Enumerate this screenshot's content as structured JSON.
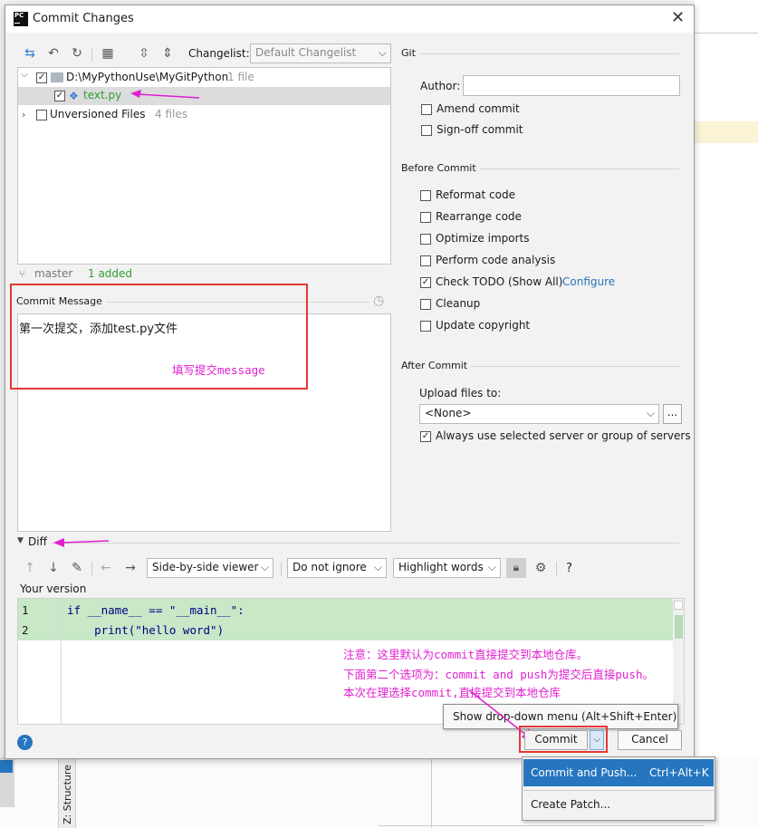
{
  "title": "Commit Changes",
  "toolbar": {
    "changelist_label": "Changelist:",
    "changelist_value": "Default Changelist"
  },
  "tree": {
    "root": {
      "path": "D:\\MyPythonUse\\MyGitPython",
      "count": "1 file"
    },
    "file": "text.py",
    "unversioned": {
      "label": "Unversioned Files",
      "count": "4 files"
    }
  },
  "status": {
    "branch": "master",
    "summary": "1 added"
  },
  "commit_message": {
    "label": "Commit Message",
    "text": "第一次提交，添加test.py文件",
    "annotation": "填写提交message"
  },
  "git": {
    "section": "Git",
    "author_label": "Author:",
    "author_value": "",
    "amend": "Amend commit",
    "signoff": "Sign-off commit"
  },
  "before_commit": {
    "section": "Before Commit",
    "options": [
      {
        "label": "Reformat code",
        "checked": false
      },
      {
        "label": "Rearrange code",
        "checked": false
      },
      {
        "label": "Optimize imports",
        "checked": false
      },
      {
        "label": "Perform code analysis",
        "checked": false
      },
      {
        "label": "Check TODO (Show All)",
        "checked": true
      },
      {
        "label": "Cleanup",
        "checked": false
      },
      {
        "label": "Update copyright",
        "checked": false
      }
    ],
    "configure_link": "Configure"
  },
  "after_commit": {
    "section": "After Commit",
    "upload_label": "Upload files to:",
    "upload_value": "<None>",
    "browse": "...",
    "always_use": "Always use selected server or group of servers"
  },
  "diff": {
    "label": "Diff",
    "viewer": "Side-by-side viewer",
    "ignore": "Do not ignore",
    "highlight": "Highlight words",
    "help": "?",
    "your_version": "Your version",
    "lines": [
      {
        "num": "1",
        "code": "if __name__ == \"__main__\":"
      },
      {
        "num": "2",
        "code": "    print(\"hello word\")"
      }
    ]
  },
  "notes": [
    "注意：这里默认为commit直接提交到本地仓库。",
    "下面第二个选项为：commit and push为提交后直接push。",
    "本次在理选择commit,直接提交到本地仓库"
  ],
  "tooltip": "Show drop-down menu (Alt+Shift+Enter)",
  "buttons": {
    "commit": "Commit",
    "cancel": "Cancel",
    "help": "?"
  },
  "dropdown": {
    "items": [
      {
        "label": "Commit and Push...",
        "shortcut": "Ctrl+Alt+K"
      },
      {
        "label": "Create Patch...",
        "shortcut": ""
      }
    ]
  },
  "background": {
    "structure_tab": "Z: Structure"
  },
  "colors": {
    "accent_blue": "#2675bf",
    "diff_added_bg": "#c8e8c8",
    "annotation_magenta": "#e020d0",
    "highlight_red": "#e53935"
  }
}
